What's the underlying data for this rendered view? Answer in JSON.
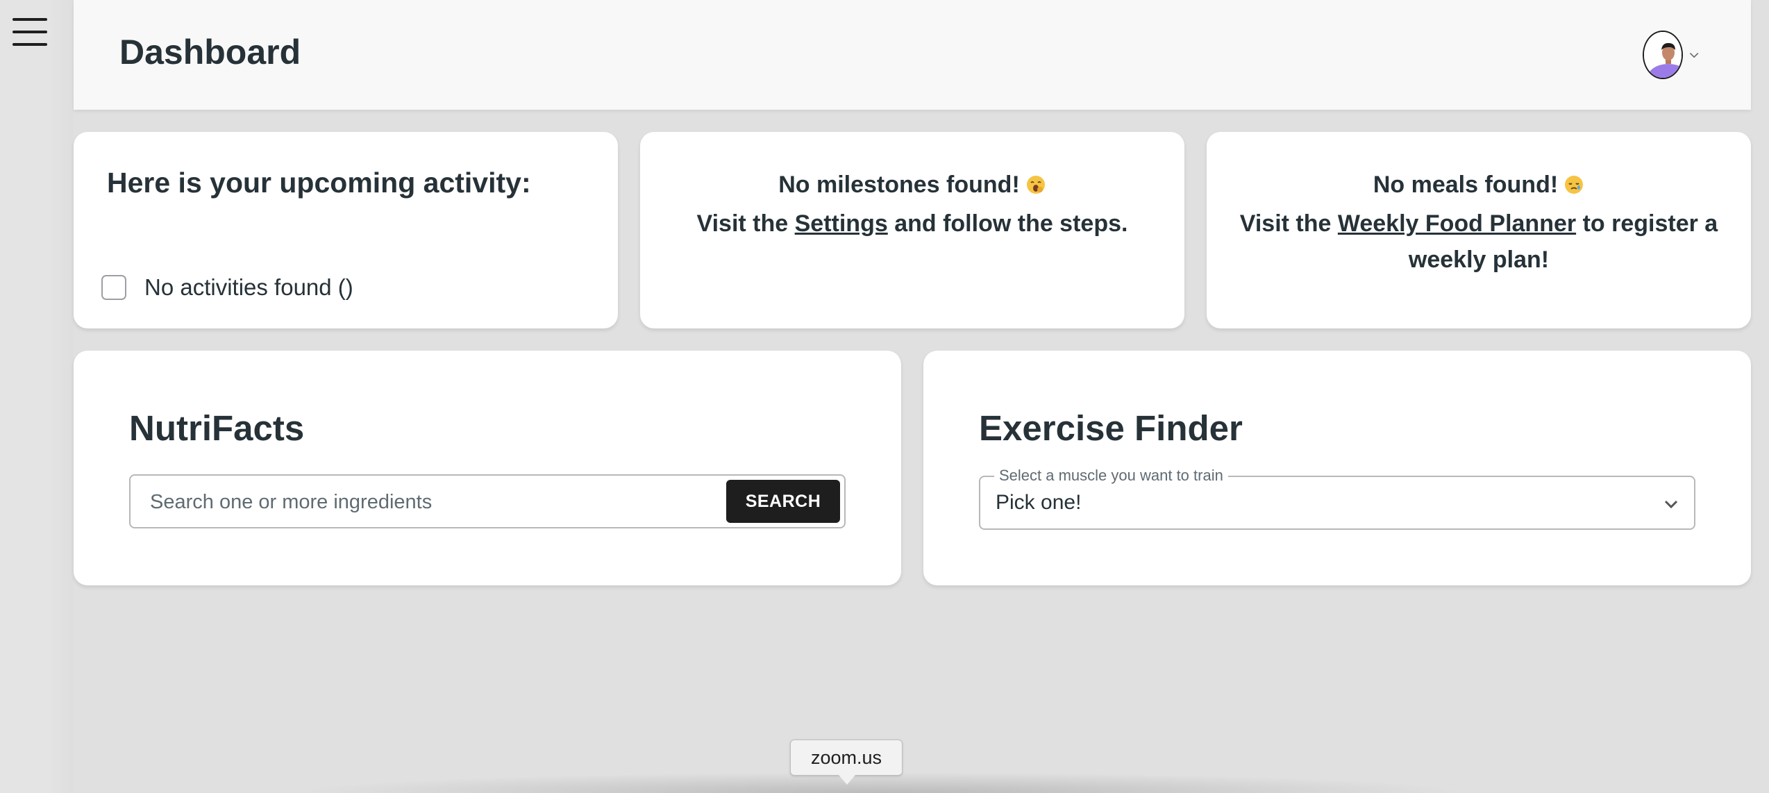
{
  "header": {
    "title": "Dashboard",
    "menu_icon": "hamburger-menu-icon",
    "avatar_icon": "user-avatar-icon",
    "avatar_menu_icon": "chevron-down-icon"
  },
  "activity_card": {
    "heading": "Here is your upcoming activity:",
    "empty_label": "No activities found ()",
    "checked": false
  },
  "milestones_card": {
    "line1": "No milestones found!",
    "emoji1": "yawning-face-emoji",
    "prefix": "Visit the",
    "link": "Settings",
    "suffix": "and follow the steps."
  },
  "meals_card": {
    "line1": "No meals found!",
    "emoji1": "sleepy-face-emoji",
    "prefix": "Visit the",
    "link": "Weekly Food Planner",
    "suffix": "to register a weekly plan!"
  },
  "nutrifacts": {
    "title": "NutriFacts",
    "placeholder": "Search one or more ingredients",
    "value": "",
    "button": "SEARCH"
  },
  "exercise_finder": {
    "title": "Exercise Finder",
    "select_label": "Select a muscle you want to train",
    "selected": "Pick one!"
  },
  "zoom_tooltip": {
    "text": "zoom.us"
  },
  "colors": {
    "background": "#e0e0e0",
    "topbar": "#f8f8f8",
    "card": "#ffffff",
    "text": "#263238",
    "button": "#1e1e1e"
  }
}
